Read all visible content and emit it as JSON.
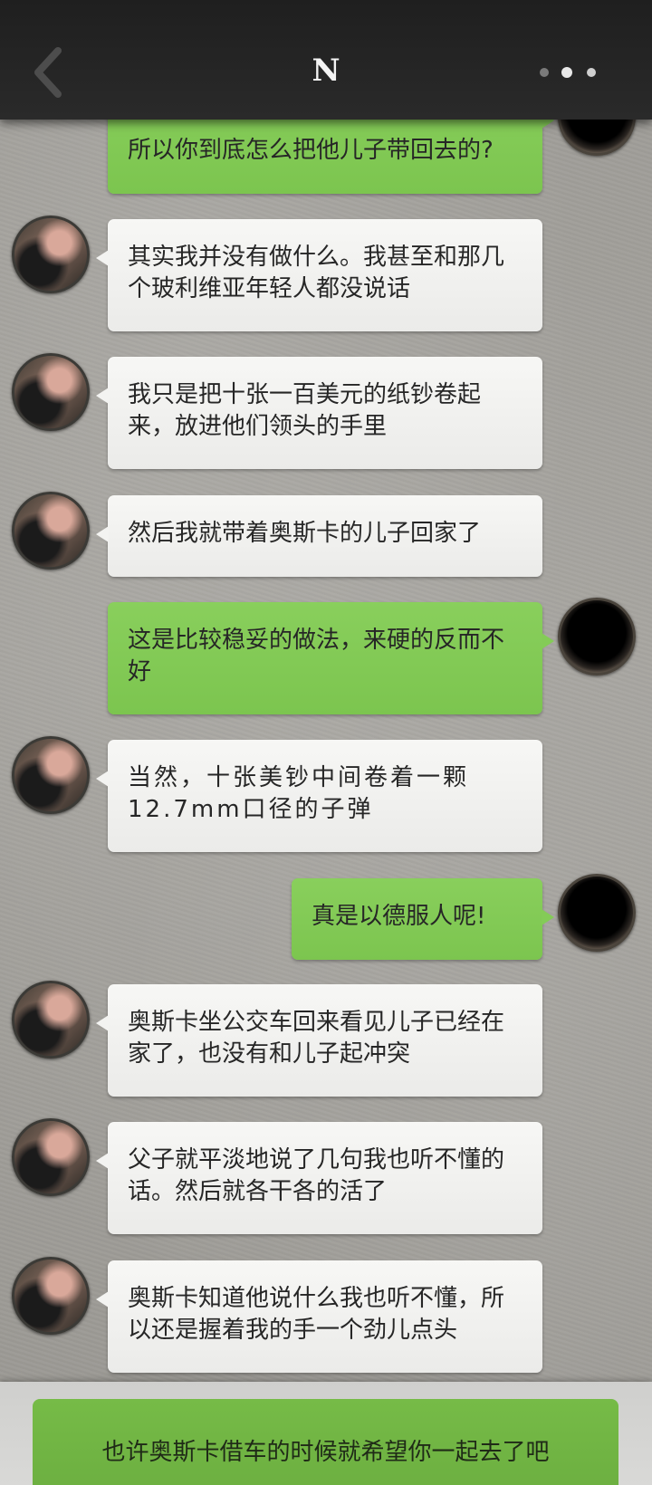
{
  "header": {
    "title": "N",
    "back_icon": "chevron-left-icon",
    "more_icon": "more-dots-icon"
  },
  "messages": [
    {
      "sender": "me",
      "text": "所以你到底怎么把他儿子带回去的?"
    },
    {
      "sender": "friend",
      "text": "其实我并没有做什么。我甚至和那几个玻利维亚年轻人都没说话"
    },
    {
      "sender": "friend",
      "text": "我只是把十张一百美元的纸钞卷起来，放进他们领头的手里"
    },
    {
      "sender": "friend",
      "text": "然后我就带着奥斯卡的儿子回家了"
    },
    {
      "sender": "me",
      "text": "这是比较稳妥的做法，来硬的反而不好"
    },
    {
      "sender": "friend",
      "text": "当然，十张美钞中间卷着一颗12.7mm口径的子弹"
    },
    {
      "sender": "me",
      "text": "真是以德服人呢!"
    },
    {
      "sender": "friend",
      "text": "奥斯卡坐公交车回来看见儿子已经在家了，也没有和儿子起冲突"
    },
    {
      "sender": "friend",
      "text": "父子就平淡地说了几句我也听不懂的话。然后就各干各的活了"
    },
    {
      "sender": "friend",
      "text": "奥斯卡知道他说什么我也听不懂，所以还是握着我的手一个劲儿点头"
    }
  ],
  "reply_option": {
    "text": "也许奥斯卡借车的时候就希望你一起去了吧"
  },
  "colors": {
    "header_bg": "#232323",
    "bubble_friend": "#f3f3f1",
    "bubble_me": "#84cb57",
    "reply_button": "#72b644",
    "background": "#a09e99"
  }
}
